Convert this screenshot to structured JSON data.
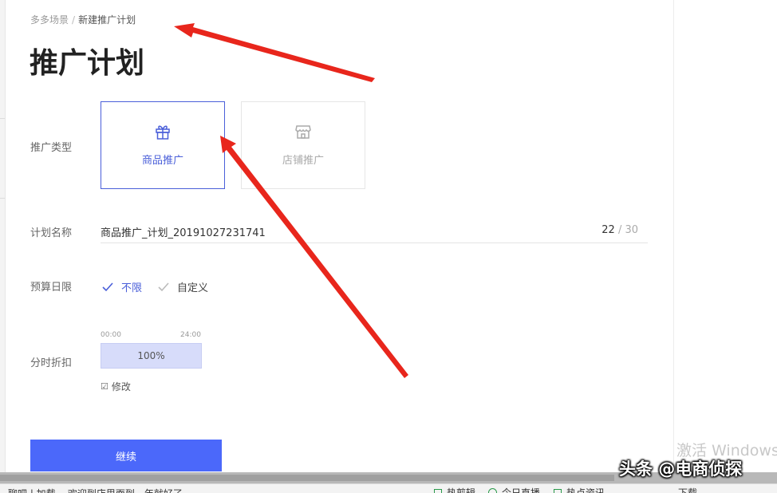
{
  "breadcrumb": {
    "parent": "多多场景",
    "separator": "/",
    "current": "新建推广计划"
  },
  "page_title": "推广计划",
  "promo_type": {
    "label": "推广类型",
    "options": [
      {
        "label": "商品推广",
        "icon": "gift-icon",
        "selected": true
      },
      {
        "label": "店铺推广",
        "icon": "store-icon",
        "selected": false
      }
    ]
  },
  "plan_name": {
    "label": "计划名称",
    "value": "商品推广_计划_20191027231741",
    "count": "22",
    "max": "/ 30"
  },
  "budget": {
    "label": "预算日限",
    "options": [
      {
        "label": "不限",
        "selected": true
      },
      {
        "label": "自定义",
        "selected": false
      }
    ]
  },
  "time_discount": {
    "label": "分时折扣",
    "start": "00:00",
    "end": "24:00",
    "value": "100%",
    "edit_icon": "☑",
    "edit_label": "修改"
  },
  "continue_button": "继续",
  "os_overlay": {
    "activate": "激活 Windows"
  },
  "watermark": "头条 @电商侦探",
  "status_bar": {
    "left": "聊吧 | 加载... 欢迎到店里面到一年就好了",
    "items": [
      "热剪辑",
      "今日直播",
      "热点资讯",
      "下载"
    ]
  },
  "colors": {
    "accent": "#4a5fd9",
    "button": "#4b68fa",
    "bar": "#d7dcfa",
    "arrow": "#e8261c"
  }
}
